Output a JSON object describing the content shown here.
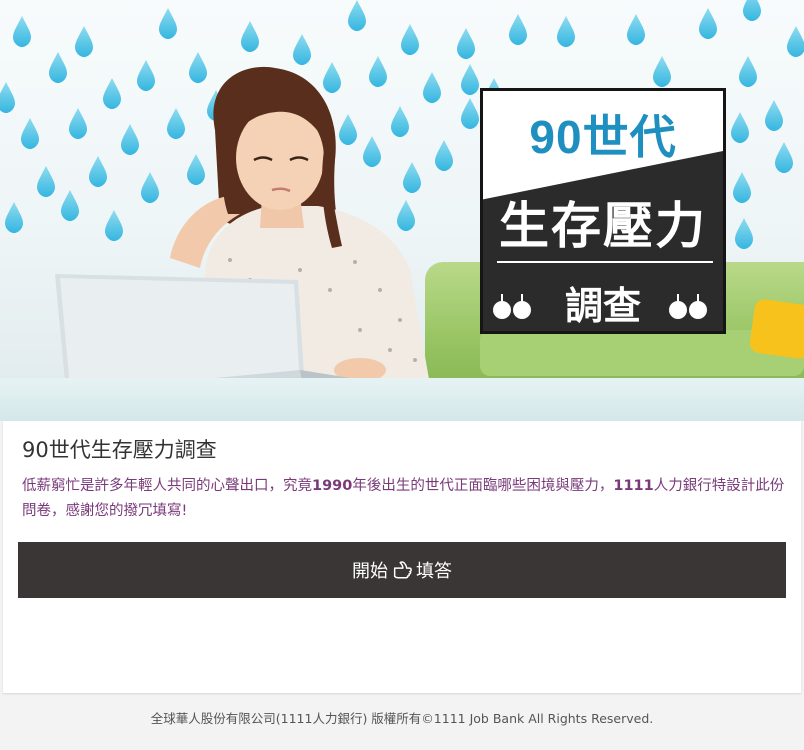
{
  "hero": {
    "badge": {
      "top_text": "90世代",
      "main_text": "生存壓力",
      "sub_text": "調查"
    }
  },
  "survey": {
    "title": "90世代生存壓力調查",
    "description_parts": [
      "低薪窮忙是許多年輕人共同的心聲出口，究竟",
      "1990",
      "年後出生的世代正面臨哪些困境與壓力，",
      "1111",
      "人力銀行特設計此份問卷，感謝您的撥冗填寫!"
    ],
    "start_label_before": "開始",
    "start_label_after": "填答"
  },
  "footer": {
    "copyright": "全球華人股份有限公司(1111人力銀行) 版權所有©1111 Job Bank All Rights Reserved."
  },
  "colors": {
    "accent_text": "#7a3a7a",
    "button_bg": "#3a3636",
    "badge_blue": "#1f8fc0"
  }
}
